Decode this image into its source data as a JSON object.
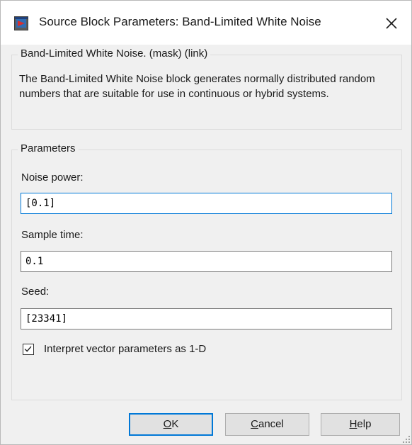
{
  "window": {
    "title": "Source Block Parameters: Band-Limited White Noise",
    "icon": "simulink-block-icon",
    "close_icon": "close-icon"
  },
  "description_group": {
    "legend": "Band-Limited White Noise. (mask) (link)",
    "text": "The Band-Limited White Noise block generates normally distributed random numbers that are suitable for use in continuous or hybrid systems."
  },
  "parameters_group": {
    "legend": "Parameters",
    "fields": [
      {
        "label": "Noise power:",
        "value": "[0.1]"
      },
      {
        "label": "Sample time:",
        "value": "0.1"
      },
      {
        "label": "Seed:",
        "value": "[23341]"
      }
    ],
    "checkbox": {
      "label": "Interpret vector parameters as 1-D",
      "checked": true
    }
  },
  "buttons": {
    "ok": {
      "mnemonic": "O",
      "rest": "K"
    },
    "cancel": {
      "mnemonic": "C",
      "rest": "ancel"
    },
    "help": {
      "mnemonic": "H",
      "rest": "elp"
    }
  },
  "colors": {
    "focus_accent": "#0078d7",
    "dialog_bg": "#f0f0f0",
    "titlebar_bg": "#ffffff"
  }
}
